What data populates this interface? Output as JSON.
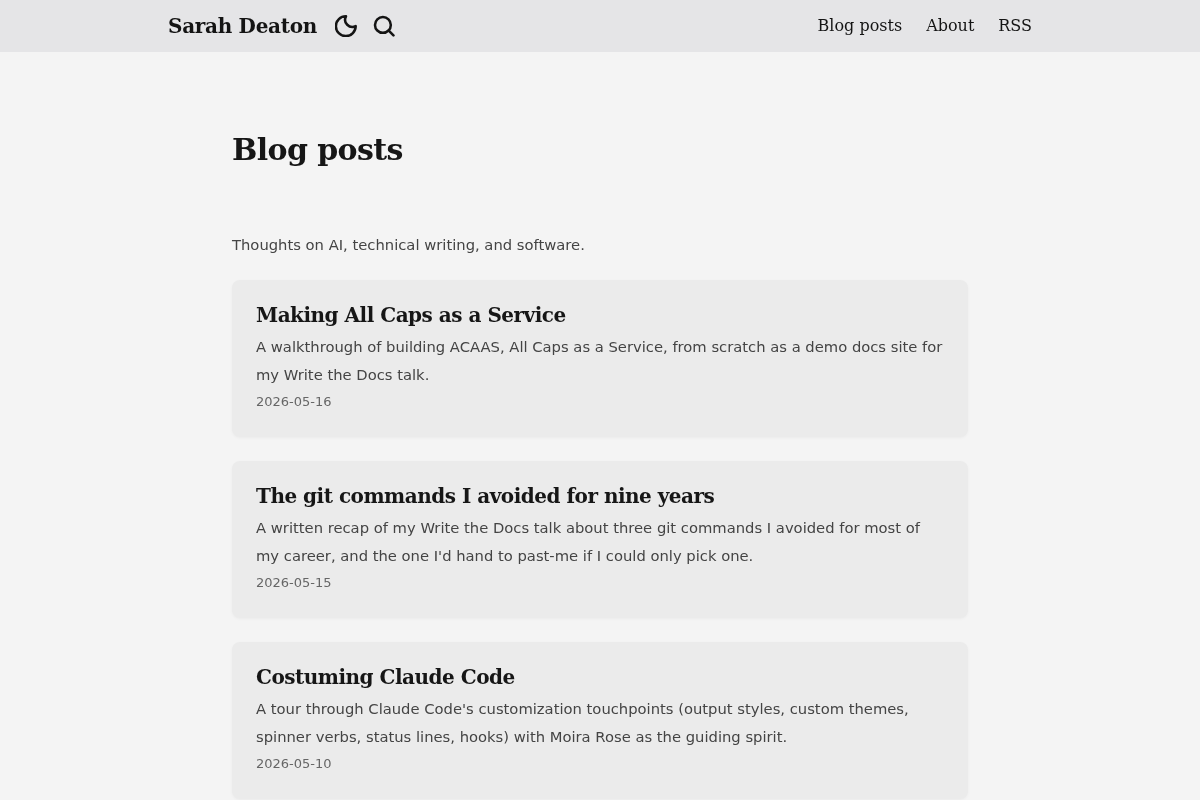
{
  "header": {
    "site_title": "Sarah Deaton",
    "nav_links": [
      "Blog posts",
      "About",
      "RSS"
    ]
  },
  "page": {
    "title": "Blog posts",
    "intro": "Thoughts on AI, technical writing, and software."
  },
  "posts": [
    {
      "title": "Making All Caps as a Service",
      "summary": "A walkthrough of building ACAAS, All Caps as a Service, from scratch as a demo docs site for my Write the Docs talk.",
      "date": "2026-05-16"
    },
    {
      "title": "The git commands I avoided for nine years",
      "summary": "A written recap of my Write the Docs talk about three git commands I avoided for most of my career, and the one I'd hand to past-me if I could only pick one.",
      "date": "2026-05-15"
    },
    {
      "title": "Costuming Claude Code",
      "summary": "A tour through Claude Code's customization touchpoints (output styles, custom themes, spinner verbs, status lines, hooks) with Moira Rose as the guiding spirit.",
      "date": "2026-05-10"
    }
  ]
}
